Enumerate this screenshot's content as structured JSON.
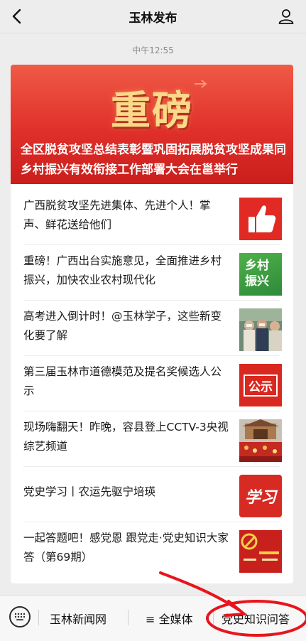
{
  "header": {
    "title": "玉林发布",
    "back_icon": "chevron-left-icon",
    "profile_icon": "person-icon"
  },
  "timestamp": "中午12:55",
  "hero": {
    "headline_big": "重磅",
    "title": "全区脱贫攻坚总结表彰暨巩固拓展脱贫攻坚成果同乡村振兴有效衔接工作部署大会在邕举行"
  },
  "articles": [
    {
      "title": "广西脱贫攻坚先进集体、先进个人！掌声、鲜花送给他们",
      "thumb": "thumbs-up-icon"
    },
    {
      "title": "重磅！广西出台实施意见，全面推进乡村振兴，加快农业农村现代化",
      "thumb_text": "乡村\n振兴"
    },
    {
      "title": "高考进入倒计时！@玉林学子，这些新变化要了解",
      "thumb": "students-photo"
    },
    {
      "title": "第三届玉林市道德模范及提名奖候选人公示",
      "thumb_text": "公示"
    },
    {
      "title": "现场嗨翻天！昨晚，容县登上CCTV-3央视综艺频道",
      "thumb": "stage-photo"
    },
    {
      "title": "党史学习丨农运先驱宁培瑛",
      "thumb_text": "学习"
    },
    {
      "title": "一起答题吧！感党恩 跟党走·党史知识大家答（第69期）",
      "thumb": "party-emblem-photo"
    }
  ],
  "bottom_menu": {
    "keyboard_icon": "keyboard-icon",
    "items": [
      "玉林新闻网",
      "≡ 全媒体",
      "党史知识问答"
    ]
  },
  "colors": {
    "hero_red": "#e0302a",
    "annotation_red": "#e8141c"
  }
}
